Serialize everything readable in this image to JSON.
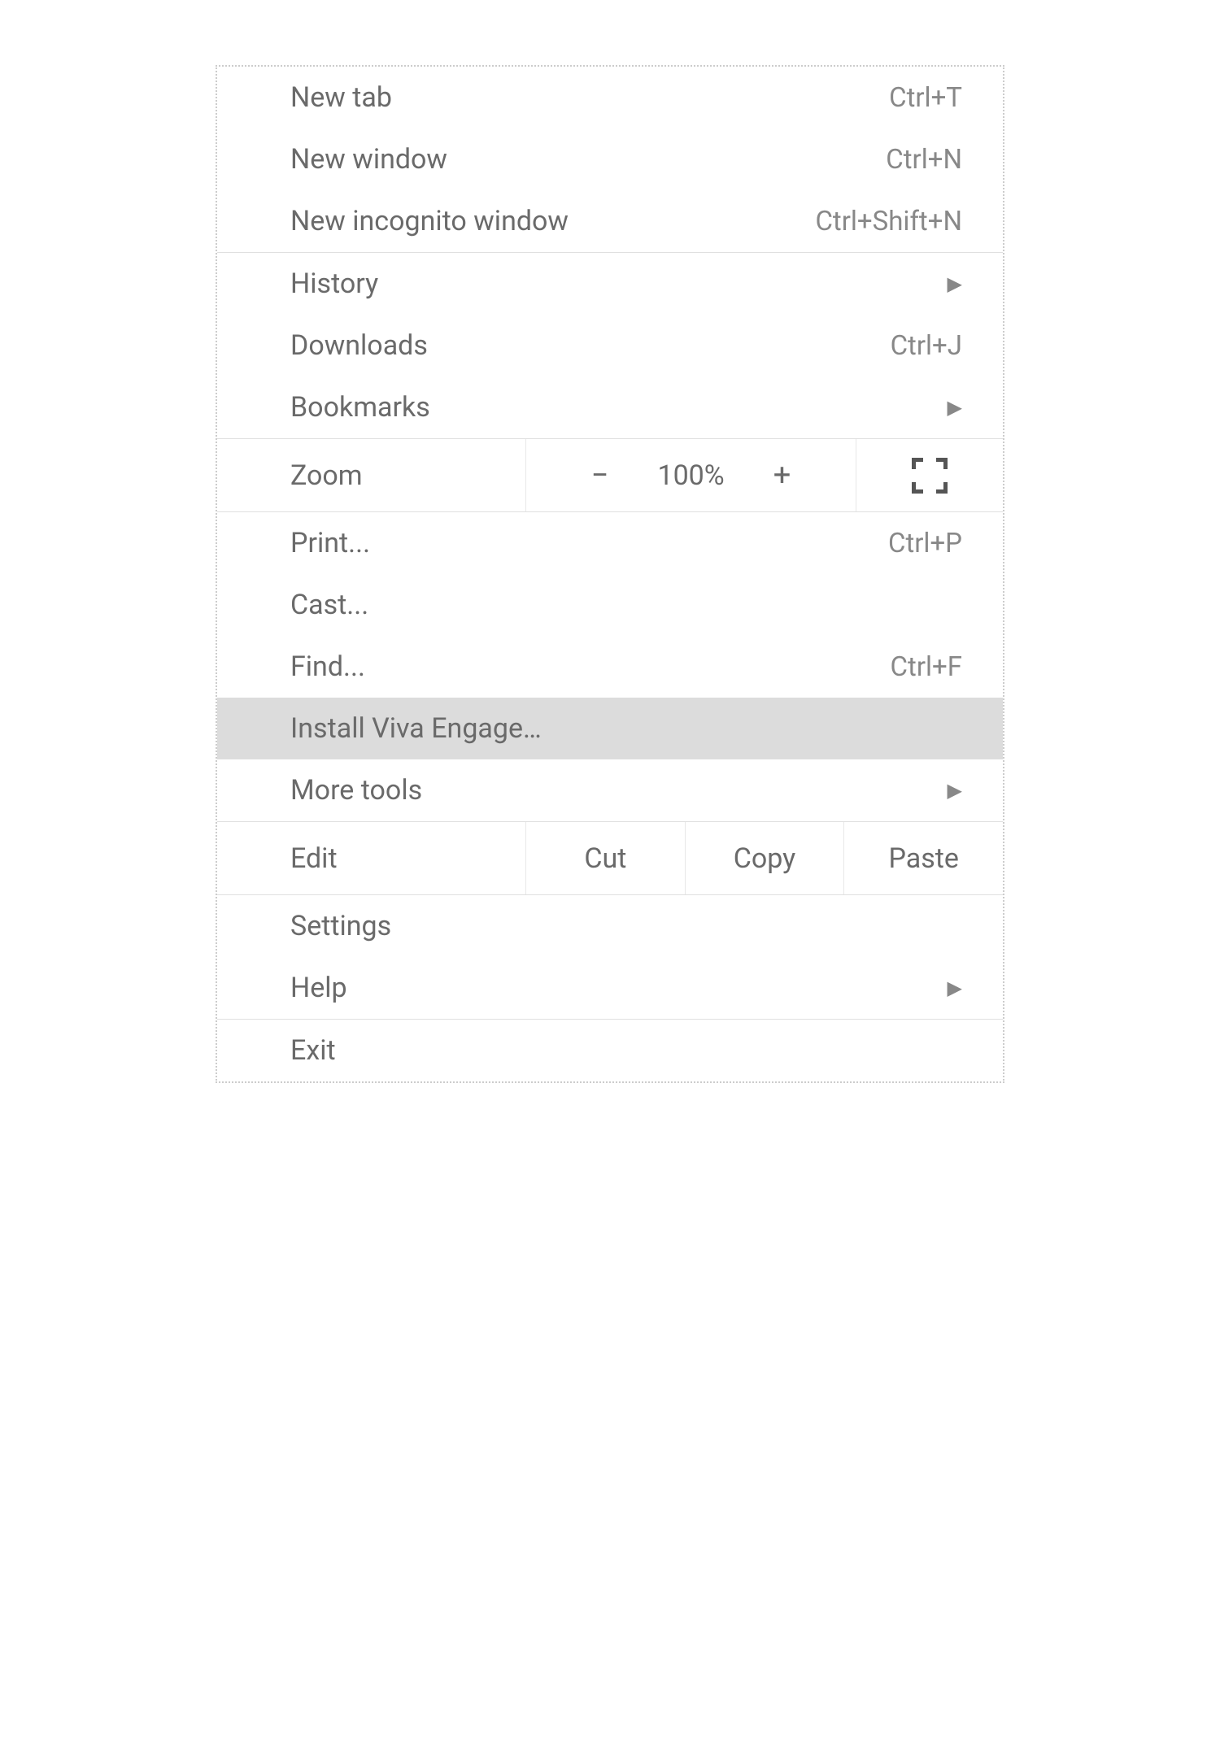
{
  "menu": {
    "section1": {
      "new_tab": {
        "label": "New tab",
        "shortcut": "Ctrl+T"
      },
      "new_window": {
        "label": "New window",
        "shortcut": "Ctrl+N"
      },
      "new_incognito": {
        "label": "New incognito window",
        "shortcut": "Ctrl+Shift+N"
      }
    },
    "section2": {
      "history": {
        "label": "History"
      },
      "downloads": {
        "label": "Downloads",
        "shortcut": "Ctrl+J"
      },
      "bookmarks": {
        "label": "Bookmarks"
      }
    },
    "zoom": {
      "label": "Zoom",
      "minus": "−",
      "value": "100%",
      "plus": "+"
    },
    "section4": {
      "print": {
        "label": "Print...",
        "shortcut": "Ctrl+P"
      },
      "cast": {
        "label": "Cast..."
      },
      "find": {
        "label": "Find...",
        "shortcut": "Ctrl+F"
      },
      "install": {
        "label": "Install Viva Engage…"
      },
      "more_tools": {
        "label": "More tools"
      }
    },
    "edit": {
      "label": "Edit",
      "cut": "Cut",
      "copy": "Copy",
      "paste": "Paste"
    },
    "section6": {
      "settings": {
        "label": "Settings"
      },
      "help": {
        "label": "Help"
      }
    },
    "section7": {
      "exit": {
        "label": "Exit"
      }
    }
  }
}
